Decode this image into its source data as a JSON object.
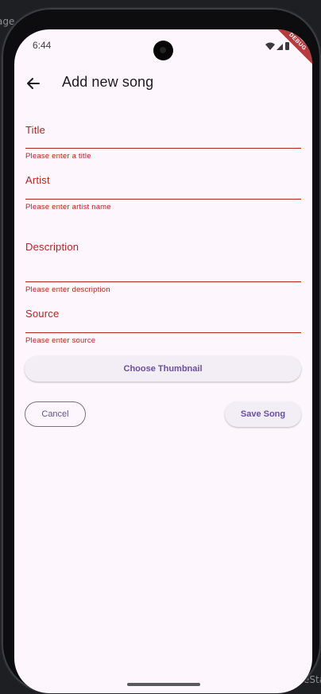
{
  "ide_background": {
    "left_fragment": "age",
    "right_fragment": "eState"
  },
  "status_bar": {
    "time": "6:44",
    "debug_banner": "DEBUG"
  },
  "app_bar": {
    "title": "Add new song",
    "back_icon": "arrow-back-icon"
  },
  "form": {
    "fields": [
      {
        "label": "Title",
        "error": "Please enter a title"
      },
      {
        "label": "Artist",
        "error": "Please enter artist name"
      },
      {
        "label": "Description",
        "error": "Please enter description"
      },
      {
        "label": "Source",
        "error": "Please enter source"
      }
    ],
    "choose_thumbnail_label": "Choose Thumbnail",
    "cancel_label": "Cancel",
    "save_label": "Save Song"
  },
  "colors": {
    "error": "#b3261e",
    "primary": "#6750a4",
    "surface": "#fdf6fd",
    "debug_ribbon": "#b83a3f"
  }
}
